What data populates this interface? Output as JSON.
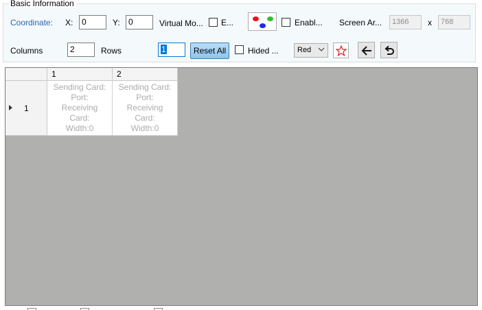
{
  "group": {
    "title": "Basic Information"
  },
  "coordinate": {
    "label": "Coordinate:",
    "x_label": "X:",
    "x_value": "0",
    "y_label": "Y:",
    "y_value": "0"
  },
  "virtual_mode": {
    "label": "Virtual Mo...",
    "checkbox_label": "E..."
  },
  "enable": {
    "label": "Enabl..."
  },
  "screen_area": {
    "label": "Screen Ar...",
    "width": "1366",
    "separator": "x",
    "height": "768"
  },
  "layout": {
    "columns_label": "Columns",
    "columns_value": "2",
    "rows_label": "Rows",
    "rows_value": "1"
  },
  "buttons": {
    "reset_all": "Reset All"
  },
  "hided": {
    "label": "Hided ..."
  },
  "color_select": {
    "selected": "Red"
  },
  "colors": {
    "red": "#e8141b",
    "green": "#2fc02f",
    "blue": "#1b2de8",
    "star": "#d6232a",
    "accent": "#2b66b0"
  },
  "icons": {
    "color_map": "rgb-dots-icon",
    "star": "star-icon",
    "back": "arrow-left-icon",
    "undo": "undo-icon",
    "chevron": "chevron-down-icon",
    "row_indicator": "row-pointer-icon"
  },
  "grid": {
    "col_headers": [
      "1",
      "2"
    ],
    "rows": [
      {
        "header": "1",
        "cells": [
          [
            "Sending Card:",
            "Port:",
            "Receiving",
            "Card:",
            "Width:0"
          ],
          [
            "Sending Card:",
            "Port:",
            "Receiving",
            "Card:",
            "Width:0"
          ]
        ]
      }
    ]
  }
}
